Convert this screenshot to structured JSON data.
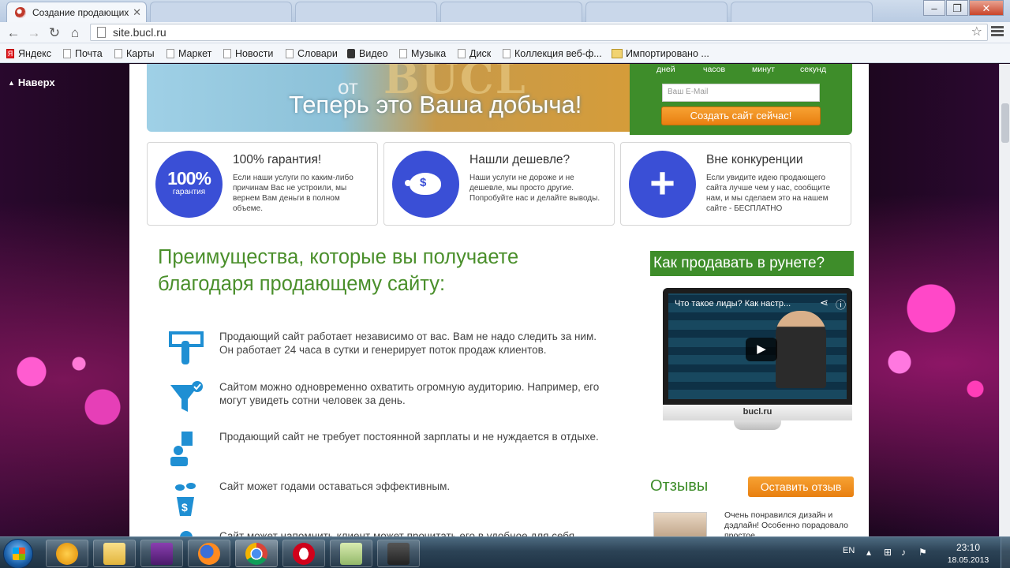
{
  "browser": {
    "active_tab_title": "Создание продающих",
    "url": "site.bucl.ru",
    "bookmarks": [
      "Яндекс",
      "Почта",
      "Карты",
      "Маркет",
      "Новости",
      "Словари",
      "Видео",
      "Музыка",
      "Диск",
      "Коллекция веб-ф...",
      "Импортировано ..."
    ]
  },
  "page": {
    "to_top": "Наверх",
    "banner": {
      "ot": "от",
      "slogan": "Теперь это Ваша добыча!",
      "big": "BUCL"
    },
    "countdown": {
      "days": "дней",
      "hours": "часов",
      "minutes": "минут",
      "seconds": "секунд"
    },
    "signup": {
      "email_placeholder": "Ваш E-Mail",
      "button": "Создать сайт сейчас!"
    },
    "features": [
      {
        "badge_big": "100%",
        "badge_small": "гарантия",
        "title": "100% гарантия!",
        "text": "Если наши услуги по каким-либо причинам Вас не устроили, мы вернем Вам деньги в полном объеме."
      },
      {
        "title": "Нашли дешевле?",
        "text": "Наши услуги не дороже и не дешевле, мы просто другие. Попробуйте нас и делайте выводы."
      },
      {
        "badge_big": "+",
        "title": "Вне конкуренции",
        "text": "Если увидите идею продающего сайта лучше чем у нас, сообщите нам, и мы сделаем это на нашем сайте - БЕСПЛАТНО"
      }
    ],
    "advantages_title": "Преимущества, которые вы получаете благодаря продающему сайту:",
    "advantages": [
      "Продающий сайт работает независимо от вас. Вам не надо следить за ним. Он работает 24 часа в сутки и генерирует поток продаж клиентов.",
      "Сайтом можно одновременно охватить огромную аудиторию. Например, его могут увидеть сотни человек за день.",
      "Продающий сайт не требует постоянной зарплаты и не нуждается в отдыхе.",
      "Сайт может годами оставаться эффективным.",
      "Сайт может напомнить клиент может прочитать его в удобное для себя"
    ],
    "how_title": "Как продавать в рунете?",
    "video": {
      "title": "Что такое лиды? Как настр...",
      "brand": "bucl.ru"
    },
    "reviews_title": "Отзывы",
    "review_button": "Оставить отзыв",
    "review_text": "Очень понравился дизайн и дэдлайн! Особенно порадовало простое"
  },
  "taskbar": {
    "lang": "EN",
    "time": "23:10",
    "date": "18.05.2013"
  },
  "colors": {
    "green": "#3e8d2a",
    "orange": "#f28a1c",
    "blue": "#3a4fd6"
  }
}
